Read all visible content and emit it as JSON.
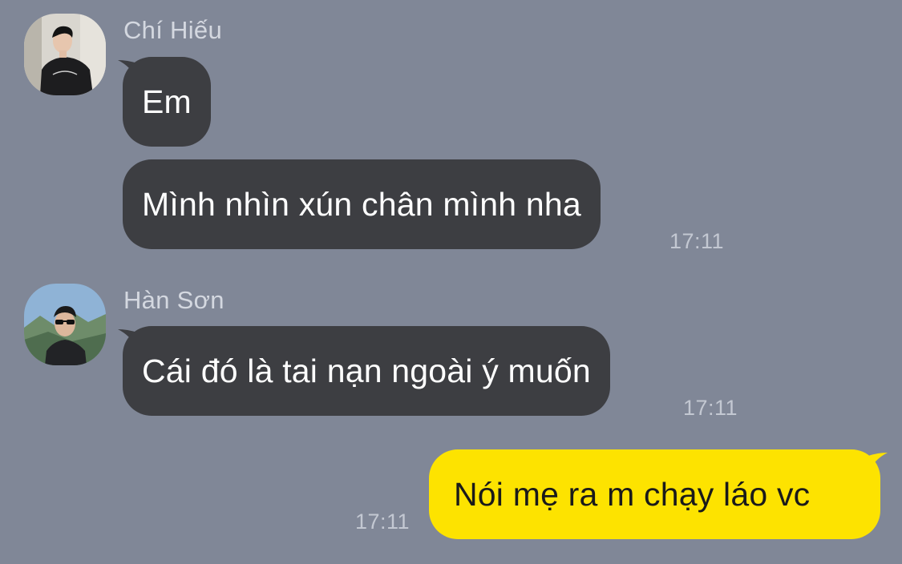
{
  "conversation": {
    "groups": [
      {
        "sender": "Chí Hiếu",
        "avatar_icon": "user-photo-icon",
        "messages": [
          {
            "text": "Em"
          },
          {
            "text": "Mình nhìn xún chân mình nha",
            "time": "17:11"
          }
        ]
      },
      {
        "sender": "Hàn Sơn",
        "avatar_icon": "user-photo-icon",
        "messages": [
          {
            "text": "Cái đó là tai nạn ngoài ý muốn",
            "time": "17:11"
          }
        ]
      }
    ],
    "outgoing": [
      {
        "text": "Nói mẹ ra m chạy láo vc",
        "time": "17:11"
      }
    ]
  },
  "colors": {
    "background": "#808797",
    "incoming_bubble": "#3d3e42",
    "outgoing_bubble": "#fde300",
    "sender_name": "#d4d8e0",
    "timestamp": "#c3c8d2"
  }
}
